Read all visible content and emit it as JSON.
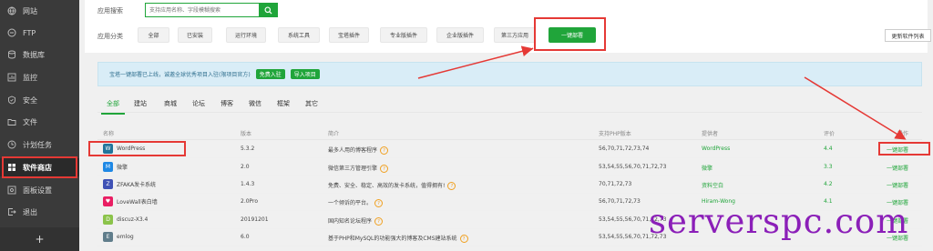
{
  "sidebar": {
    "items": [
      {
        "label": "网站",
        "icon": "globe-icon"
      },
      {
        "label": "FTP",
        "icon": "ftp-icon"
      },
      {
        "label": "数据库",
        "icon": "database-icon"
      },
      {
        "label": "监控",
        "icon": "monitor-icon"
      },
      {
        "label": "安全",
        "icon": "shield-icon"
      },
      {
        "label": "文件",
        "icon": "folder-icon"
      },
      {
        "label": "计划任务",
        "icon": "clock-icon"
      },
      {
        "label": "软件商店",
        "icon": "grid-icon"
      },
      {
        "label": "面板设置",
        "icon": "gear-icon"
      },
      {
        "label": "退出",
        "icon": "logout-icon"
      }
    ],
    "add_label": "+"
  },
  "search": {
    "label": "应用搜索",
    "placeholder": "支持应用名称、字段模糊搜索"
  },
  "categories": {
    "label": "应用分类",
    "items": [
      "全部",
      "已安装",
      "运行环境",
      "系统工具",
      "宝塔插件",
      "专业版插件",
      "企业版插件",
      "第三方应用",
      "一键部署"
    ],
    "active": "一键部署",
    "refresh_label": "更新软件列表"
  },
  "notice": {
    "text": "宝塔一键部署已上线，诚邀全球优秀项目入驻(限项目官方)",
    "btn_free": "免费入驻",
    "btn_import": "导入项目"
  },
  "tabs": [
    "全部",
    "建站",
    "商城",
    "论坛",
    "博客",
    "微信",
    "框架",
    "其它"
  ],
  "table": {
    "headers": {
      "name": "名称",
      "version": "版本",
      "desc": "简介",
      "php": "支持PHP版本",
      "provider": "提供者",
      "score": "评价",
      "op": "操作"
    },
    "rows": [
      {
        "name": "WordPress",
        "version": "5.3.2",
        "desc": "最多人用的博客程序",
        "php": "56,70,71,72,73,74",
        "provider": "WordPress",
        "score": "4.4",
        "op": "一键部署",
        "icon_color": "#21759b",
        "icon_glyph": "W"
      },
      {
        "name": "微擎",
        "version": "2.0",
        "desc": "微信第三方管理引擎",
        "php": "53,54,55,56,70,71,72,73",
        "provider": "微擎",
        "score": "3.3",
        "op": "一键部署",
        "icon_color": "#1e88e5",
        "icon_glyph": "M"
      },
      {
        "name": "ZFAKA发卡系统",
        "version": "1.4.3",
        "desc": "免费、安全、稳定、高效的发卡系统，值得拥有!",
        "php": "70,71,72,73",
        "provider": "资料空白",
        "score": "4.2",
        "op": "一键部署",
        "icon_color": "#3f51b5",
        "icon_glyph": "Z"
      },
      {
        "name": "LoveWall表白墙",
        "version": "2.0Pro",
        "desc": "一个倾诉的平台。",
        "php": "56,70,71,72,73",
        "provider": "Hiram-Wong",
        "score": "4.1",
        "op": "一键部署",
        "icon_color": "#e91e63",
        "icon_glyph": "♥"
      },
      {
        "name": "discuz-X3.4",
        "version": "20191201",
        "desc": "国内知名论坛程序",
        "php": "53,54,55,56,70,71,72,73",
        "provider": "",
        "score": "",
        "op": "一键部署",
        "icon_color": "#8bc34a",
        "icon_glyph": "D"
      },
      {
        "name": "emlog",
        "version": "6.0",
        "desc": "基于PHP和MySQL的功能强大的博客及CMS建站系统",
        "php": "53,54,55,56,70,71,72,73",
        "provider": "",
        "score": "",
        "op": "一键部署",
        "icon_color": "#607d8b",
        "icon_glyph": "E"
      }
    ]
  },
  "watermark": "serverspc.com",
  "colors": {
    "accent": "#20a53a",
    "sidebar_bg": "#3a3a3a",
    "highlight": "#e53935",
    "watermark": "#8b1fb8"
  }
}
